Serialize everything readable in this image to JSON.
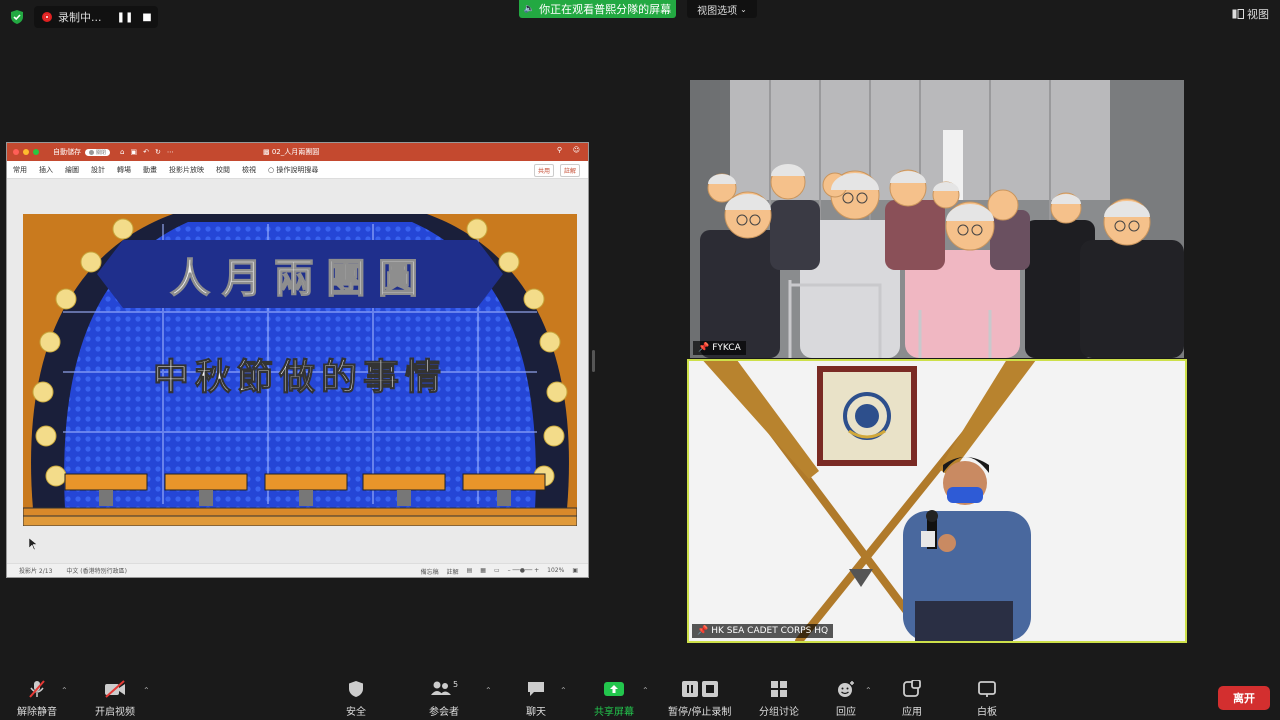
{
  "topbar": {
    "recording_label": "录制中...",
    "pause_icon": "pause-icon",
    "stop_icon": "stop-icon",
    "share_banner": "你正在观看普熙分隊的屏幕",
    "view_options": "视图选项",
    "view_button": "视图"
  },
  "shared_screen": {
    "autosave_label": "自動儲存",
    "autosave_state": "關閉",
    "doc_name": "02_人月兩團圓",
    "ribbon_tabs": [
      "常用",
      "插入",
      "繪圖",
      "設計",
      "轉場",
      "動畫",
      "投影片放映",
      "校閱",
      "檢視"
    ],
    "ribbon_search": "操作說明搜尋",
    "ribbon_share": "共用",
    "ribbon_comments": "註解",
    "slide_title": "人月兩團圓",
    "slide_subtitle": "中秋節做的事情",
    "status_slide": "投影片 2/13",
    "status_lang": "中文 (香港特別行政區)",
    "status_notes": "備忘稿",
    "status_comments": "註解",
    "status_zoom": "102%"
  },
  "videos": [
    {
      "name": "FYKCA"
    },
    {
      "name": "HK SEA CADET CORPS HQ"
    }
  ],
  "toolbar": {
    "unmute": "解除静音",
    "start_video": "开启视频",
    "security": "安全",
    "participants": "参会者",
    "participant_count": "5",
    "chat": "聊天",
    "share_screen": "共享屏幕",
    "pause_stop_recording": "暂停/停止录制",
    "breakout_rooms": "分组讨论",
    "reactions": "回应",
    "apps": "应用",
    "whiteboard": "白板",
    "leave": "离开"
  },
  "colors": {
    "share_green": "#23a942",
    "leave_red": "#d32f2f",
    "active_speaker": "#cde04a",
    "ppt_accent": "#c4492f"
  }
}
